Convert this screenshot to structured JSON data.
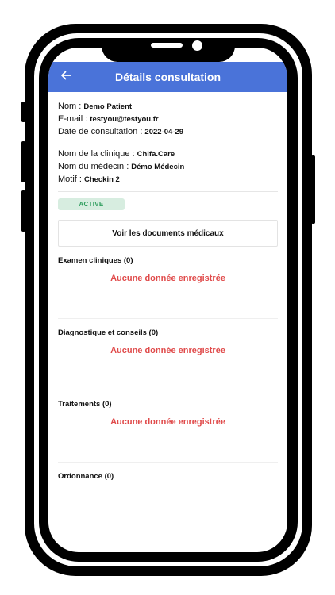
{
  "header": {
    "title": "Détails consultation"
  },
  "patient": {
    "name_label": "Nom :",
    "name_value": "Demo Patient",
    "email_label": "E-mail :",
    "email_value": "testyou@testyou.fr",
    "date_label": "Date de consultation :",
    "date_value": "2022-04-29"
  },
  "clinic": {
    "clinic_label": "Nom de la clinique :",
    "clinic_value": "Chifa.Care",
    "doctor_label": "Nom du médecin :",
    "doctor_value": "Démo Médecin",
    "reason_label": "Motif :",
    "reason_value": "Checkin 2"
  },
  "status_badge": "ACTIVE",
  "documents_button": "Voir les documents médicaux",
  "sections": [
    {
      "title": "Examen cliniques (0)",
      "empty_text": "Aucune donnée enregistrée"
    },
    {
      "title": "Diagnostique et conseils (0)",
      "empty_text": "Aucune donnée enregistrée"
    },
    {
      "title": "Traitements (0)",
      "empty_text": "Aucune donnée enregistrée"
    },
    {
      "title": "Ordonnance (0)",
      "empty_text": ""
    }
  ],
  "colors": {
    "appbar": "#4a73d9",
    "badge_bg": "#d7ede0",
    "badge_text": "#2f9e5e",
    "empty_text": "#e04b4b"
  },
  "icons": {
    "back": "arrow-left-icon"
  }
}
